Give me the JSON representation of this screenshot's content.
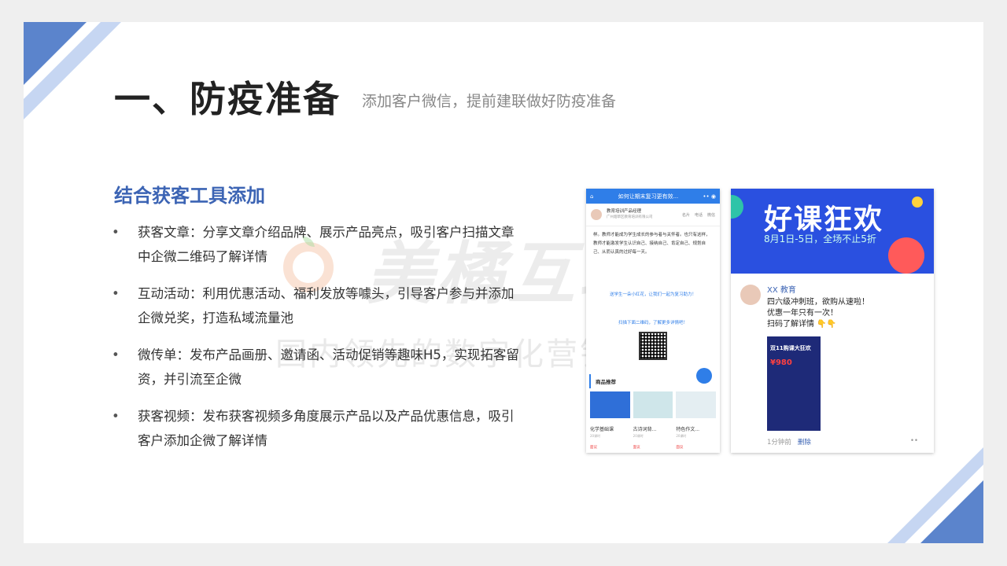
{
  "header": {
    "title": "一、防疫准备",
    "subtitle": "添加客户微信，提前建联做好防疫准备"
  },
  "section": {
    "title": "结合获客工具添加"
  },
  "bullets": [
    {
      "marker": "•",
      "text": "获客文章：分享文章介绍品牌、展示产品亮点，吸引客户扫描文章中企微二维码了解详情"
    },
    {
      "marker": "•",
      "text": "互动活动：利用优惠活动、福利发放等噱头，引导客户参与并添加企微兑奖，打造私域流量池"
    },
    {
      "marker": "•",
      "text": "微传单：发布产品画册、邀请函、活动促销等趣味H5，实现拓客留资，并引流至企微"
    },
    {
      "marker": "•",
      "text": "获客视频：发布获客视频多角度展示产品以及产品优惠信息，吸引客户添加企微了解详情"
    }
  ],
  "watermark": {
    "big": "美橘互联",
    "small": "国内领先的数字化营销服务商"
  },
  "phone": {
    "top_title": "如何让期末复习更有效...",
    "profile_name": "教育培训产品经理",
    "profile_org": "广州烟草区教育培训有限公司",
    "profile_actions": [
      "名片",
      "电话",
      "微信"
    ],
    "body": "样。教师才能成为学生成长的参与者与关怀者。也只有这样，教师才能激发学生认识自己、接纳自己、肯定自己、规划自己、从而认真的过好每一天。",
    "blue_line1": "送学生一朵小红花，让我们一起为复习助力！",
    "blue_line2": "扫描下面二维码，了解更多详情吧！",
    "section": "商品推荐",
    "products": [
      {
        "name": "化学基础课",
        "sub": "20课时",
        "btn": "面议"
      },
      {
        "name": "古诗词背...",
        "sub": "20课时",
        "btn": "面议"
      },
      {
        "name": "特色作文...",
        "sub": "20课时",
        "btn": "面议"
      }
    ]
  },
  "moment": {
    "banner_title": "好课狂欢",
    "banner_sub": "8月1日-5日，全场不止5折",
    "name": "XX 教育",
    "lines": [
      "四六级冲刺班，欲购从速啦！",
      "优惠一年只有一次！",
      "扫码了解详情 👇👇"
    ],
    "poster_title": "双11购课大狂欢",
    "poster_price": "¥980",
    "time": "1分钟前",
    "delete": "删除",
    "more": "••"
  },
  "colors": {
    "accent": "#3c64b4",
    "corner_dark": "#5b84cc",
    "corner_light": "#c6d6f2"
  }
}
